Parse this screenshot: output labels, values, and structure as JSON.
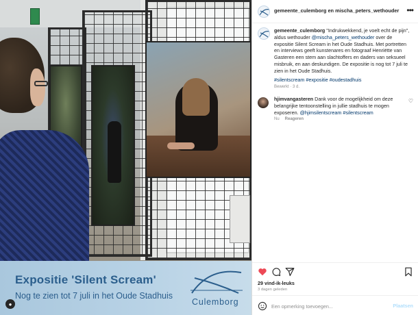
{
  "post": {
    "header_user": "gemeente_culemborg en mischa_peters_wethouder",
    "more_icon": "ellipsis-icon"
  },
  "caption": {
    "username": "gemeente_culemborg",
    "text_1": " \"Indrukwekkend, je voelt echt de pijn\", aldus wethouder ",
    "mention": "@mischa_peters_wethouder",
    "text_2": " over de expositie Silent Scream in het Oude Stadhuis. Met portretten en interviews geeft kunstenares en fotograaf Henriëtte van Gasteren een stem aan slachtoffers en daders van seksueel misbruik, en aan deskundigen. De expositie is nog tot 7 juli te zien in het Oude Stadhuis.",
    "hashtags": "#silentscream #expositie #oudestadhuis",
    "meta": "Bewerkt · 3 d."
  },
  "comment": {
    "username": "hjimvangasteren",
    "text": " Dank voor de mogelijkheid om deze belangrijke tentoonstelling in jullie stadhuis te mogen exposeren. ",
    "mentions": "@hjimsilentscream #silentscream",
    "time": "Nu",
    "reply_label": "Reageren"
  },
  "banner": {
    "title": "Expositie 'Silent Scream'",
    "subtitle": "Nog te zien tot 7 juli in het Oude Stadhuis",
    "logo_text": "Culemborg"
  },
  "actions": {
    "likes": "29 vind-ik-leuks",
    "ago": "3 dagen geleden",
    "icons": [
      "heart-icon",
      "comment-icon",
      "share-icon",
      "bookmark-icon"
    ]
  },
  "add_comment": {
    "placeholder": "Een opmerking toevoegen...",
    "post_label": "Plaatsen"
  },
  "colors": {
    "heart": "#ed4956",
    "link": "#00376b",
    "banner_text": "#2b5e8c",
    "post_disabled": "#b2dffc"
  }
}
